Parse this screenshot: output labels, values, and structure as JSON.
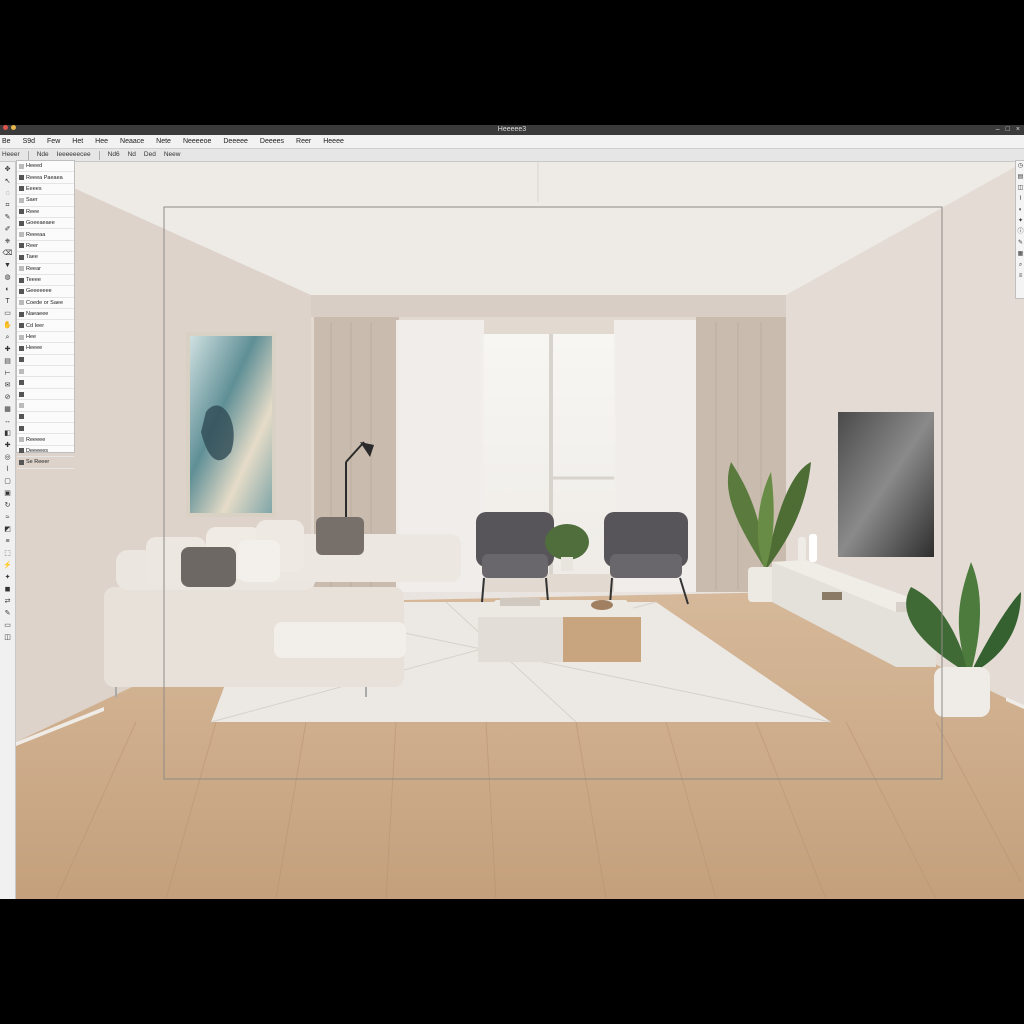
{
  "window": {
    "title": "Heeeee3"
  },
  "menu": {
    "items": [
      "Be",
      "S9d",
      "Few",
      "Het",
      "Hee",
      "Neaace",
      "Nete",
      "Neeeeoe",
      "Deeeee",
      "Deeees",
      "Reer",
      "Heeee"
    ]
  },
  "toolbar": {
    "items": [
      "Heeer",
      "Nde",
      "Ieeeeeecee",
      "Nd6",
      "Nd",
      "Ded",
      "Neew"
    ]
  },
  "panel": {
    "rows": [
      "Heeed",
      "Reeea Paeaea",
      "Eeees",
      "Saer",
      "Reee",
      "Goeeaeaee",
      "Reeeaa",
      "Reer",
      "Taee",
      "Reear",
      "Teeee",
      "Geeeeeee",
      "Coede or Saee",
      "Naeaeee",
      "Cd Ieer",
      "Hee",
      "Heeee",
      "",
      "",
      "",
      "",
      "",
      "",
      "",
      "Reeeee",
      "Deeeees",
      "Se Reeer"
    ]
  },
  "left_tools": {
    "icons": [
      "move-icon",
      "pointer-icon",
      "lasso-icon",
      "crop-icon",
      "pen-icon",
      "brush-icon",
      "stamp-icon",
      "eraser-icon",
      "fill-icon",
      "blur-icon",
      "dodge-icon",
      "text-icon",
      "shape-icon",
      "hand-icon",
      "zoom-icon",
      "eyedropper-icon",
      "gradient-icon",
      "ruler-icon",
      "note-icon",
      "slice-icon",
      "grid-icon",
      "measure-icon",
      "patch-icon",
      "heal-icon",
      "sponge-icon",
      "path-icon",
      "frame-icon",
      "artboard-icon",
      "rotate-icon",
      "warp-icon",
      "mask-icon",
      "layer-icon",
      "select-icon",
      "quick-icon",
      "magic-icon",
      "color-icon",
      "swap-icon",
      "edit-icon",
      "screen-icon",
      "view-icon"
    ]
  },
  "right_panel": {
    "icons": [
      "history-icon",
      "layers-icon",
      "channels-icon",
      "paths-icon",
      "adjust-icon",
      "styles-icon",
      "info-icon",
      "brush-preset-icon",
      "swatch-icon",
      "navigator-icon",
      "properties-icon"
    ]
  },
  "colors": {
    "titlebar": "#3b3b3b",
    "menubar": "#f2f2f2",
    "wall": "#dcd3cb",
    "floor": "#c9a887",
    "sofa": "#e9e4dd",
    "rug": "#ece9e4"
  },
  "canvas": {
    "scene": "living-room-render"
  }
}
